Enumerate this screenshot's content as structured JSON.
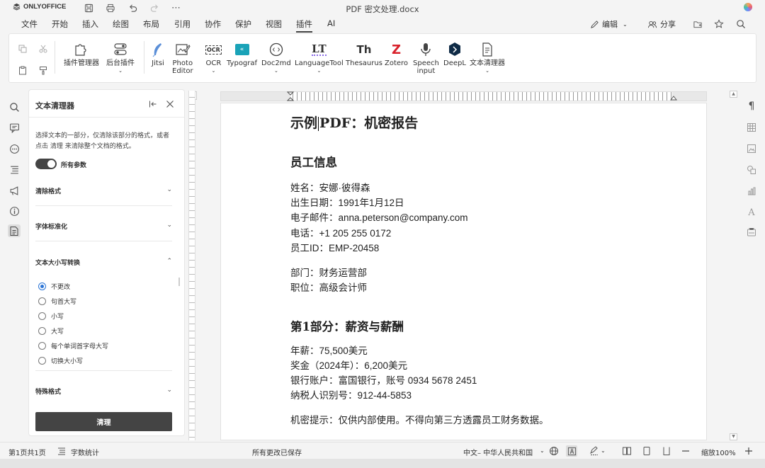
{
  "app": {
    "logo": "ONLYOFFICE",
    "doc_title": "PDF 密文处理.docx"
  },
  "menu": {
    "items": [
      "文件",
      "开始",
      "插入",
      "绘图",
      "布局",
      "引用",
      "协作",
      "保护",
      "视图",
      "插件",
      "AI"
    ],
    "active_index": 9,
    "edit_label": "编辑",
    "share_label": "分享"
  },
  "toolbar": {
    "plugin_manager": "插件管理器",
    "background_plugin": "后台插件",
    "jitsi": "Jitsi",
    "photo_editor_1": "Photo",
    "photo_editor_2": "Editor",
    "ocr_label": "OCR",
    "ocr_icon_text": "OCR",
    "typograf": "Typograf",
    "doc2md": "Doc2md",
    "languagetool": "LanguageTool",
    "languagetool_icon_text": "LT",
    "thesaurus": "Thesaurus",
    "thesaurus_icon_text": "Th",
    "zotero": "Zotero",
    "zotero_icon_text": "Z",
    "speech_1": "Speech",
    "speech_2": "input",
    "deepl": "DeepL",
    "text_cleaner": "文本清理器"
  },
  "panel": {
    "title": "文本清理器",
    "desc": "选择文本的一部分，仅清除该部分的格式，或者点击 清理 来清除整个文档的格式。",
    "toggle_label": "所有参数",
    "sec_clear": "清除格式",
    "sec_font": "字体标准化",
    "sec_case": "文本大小写转换",
    "case_options": [
      "不更改",
      "句首大写",
      "小写",
      "大写",
      "每个单词首字母大写",
      "切换大小写"
    ],
    "case_selected": 0,
    "sec_special": "特殊格式",
    "clean_button": "清理"
  },
  "document": {
    "title_1": "示例",
    "title_2": "PDF：机密报告",
    "heading_employee": "员工信息",
    "name": "姓名：安娜·彼得森",
    "dob": "出生日期：1991年1月12日",
    "email": "电子邮件：anna.peterson@company.com",
    "phone": "电话：+1 205 255 0172",
    "emp_id": "员工ID：EMP-20458",
    "dept": "部门：财务运营部",
    "position": "职位：高级会计师",
    "heading_section1": "第1部分：薪资与薪酬",
    "salary": "年薪：75,500美元",
    "bonus": "奖金（2024年）：6,200美元",
    "bank": "银行账户：富国银行，账号 0934 5678 2451",
    "tax": "纳税人识别号：912-44-5853",
    "notice": "机密提示：仅供内部使用。不得向第三方透露员工财务数据。"
  },
  "status": {
    "page": "第1页共1页",
    "word_count": "字数统计",
    "saved": "所有更改已保存",
    "language": "中文– 中华人民共和国",
    "zoom": "缩放100%"
  }
}
